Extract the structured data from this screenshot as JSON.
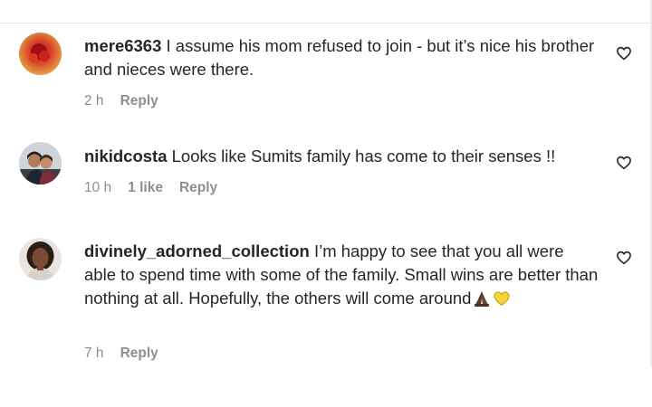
{
  "comments": [
    {
      "username": "mere6363",
      "text": "I assume his mom refused to join - but it’s nice his brother and nieces were there.",
      "time": "2 h",
      "likes": "",
      "reply_label": "Reply",
      "avatar": "red-flower-avatar"
    },
    {
      "username": "nikidcosta",
      "text": "Looks like Sumits family has come to their senses !!",
      "time": "10 h",
      "likes": "1 like",
      "reply_label": "Reply",
      "avatar": "couple-photo-avatar"
    },
    {
      "username": "divinely_adorned_collection",
      "text": "I’m happy to see that you all were able to spend time with some of the family. Small wins are better than nothing at all. Hopefully, the others will come around",
      "time": "7 h",
      "likes": "",
      "reply_label": "Reply",
      "avatar": "woman-portrait-avatar"
    }
  ],
  "icons": {
    "like": "heart-outline-icon",
    "emoji_1": "folded-hands-emoji",
    "emoji_2": "yellow-heart-emoji"
  },
  "colors": {
    "text": "#262626",
    "meta": "#8e8e8e",
    "yellow_heart": "#f5d33a"
  }
}
